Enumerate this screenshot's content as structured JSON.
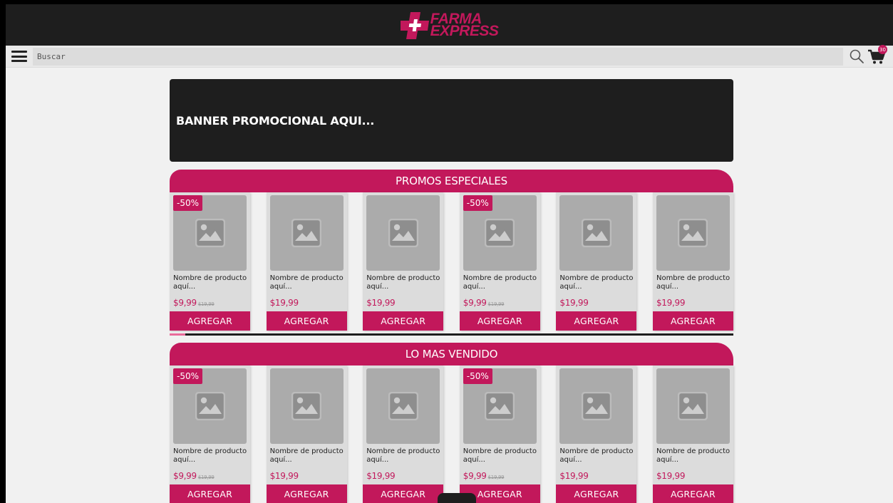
{
  "header": {
    "logo_line1": "FARMA",
    "logo_line2": "EXPRESS"
  },
  "search": {
    "placeholder": "Buscar",
    "cart_count": "30"
  },
  "banner": {
    "text": "BANNER PROMOCIONAL AQUI..."
  },
  "sections": [
    {
      "title": "PROMOS ESPECIALES",
      "products": [
        {
          "discount": "-50%",
          "name": "Nombre de producto aquí...",
          "price": "$9,99",
          "old_price": "$19,99",
          "button": "AGREGAR"
        },
        {
          "discount": "",
          "name": "Nombre de producto aquí...",
          "price": "$19,99",
          "old_price": "",
          "button": "AGREGAR"
        },
        {
          "discount": "",
          "name": "Nombre de producto aquí...",
          "price": "$19,99",
          "old_price": "",
          "button": "AGREGAR"
        },
        {
          "discount": "-50%",
          "name": "Nombre de producto aquí...",
          "price": "$9,99",
          "old_price": "$19,99",
          "button": "AGREGAR"
        },
        {
          "discount": "",
          "name": "Nombre de producto aquí...",
          "price": "$19,99",
          "old_price": "",
          "button": "AGREGAR"
        },
        {
          "discount": "",
          "name": "Nombre de producto aquí...",
          "price": "$19,99",
          "old_price": "",
          "button": "AGREGAR"
        }
      ]
    },
    {
      "title": "LO MAS VENDIDO",
      "products": [
        {
          "discount": "-50%",
          "name": "Nombre de producto aquí...",
          "price": "$9,99",
          "old_price": "$19,99",
          "button": "AGREGAR"
        },
        {
          "discount": "",
          "name": "Nombre de producto aquí...",
          "price": "$19,99",
          "old_price": "",
          "button": "AGREGAR"
        },
        {
          "discount": "",
          "name": "Nombre de producto aquí...",
          "price": "$19,99",
          "old_price": "",
          "button": "AGREGAR"
        },
        {
          "discount": "-50%",
          "name": "Nombre de producto aquí...",
          "price": "$9,99",
          "old_price": "$19,99",
          "button": "AGREGAR"
        },
        {
          "discount": "",
          "name": "Nombre de producto aquí...",
          "price": "$19,99",
          "old_price": "",
          "button": "AGREGAR"
        },
        {
          "discount": "",
          "name": "Nombre de producto aquí...",
          "price": "$19,99",
          "old_price": "",
          "button": "AGREGAR"
        }
      ]
    }
  ],
  "colors": {
    "brand": "#c2185b",
    "dark": "#1e1e1e",
    "background": "#f1f1f1",
    "placeholder_image": "#ababab"
  },
  "icons": [
    "menu-icon",
    "search-icon",
    "cart-icon",
    "image-placeholder-icon"
  ]
}
